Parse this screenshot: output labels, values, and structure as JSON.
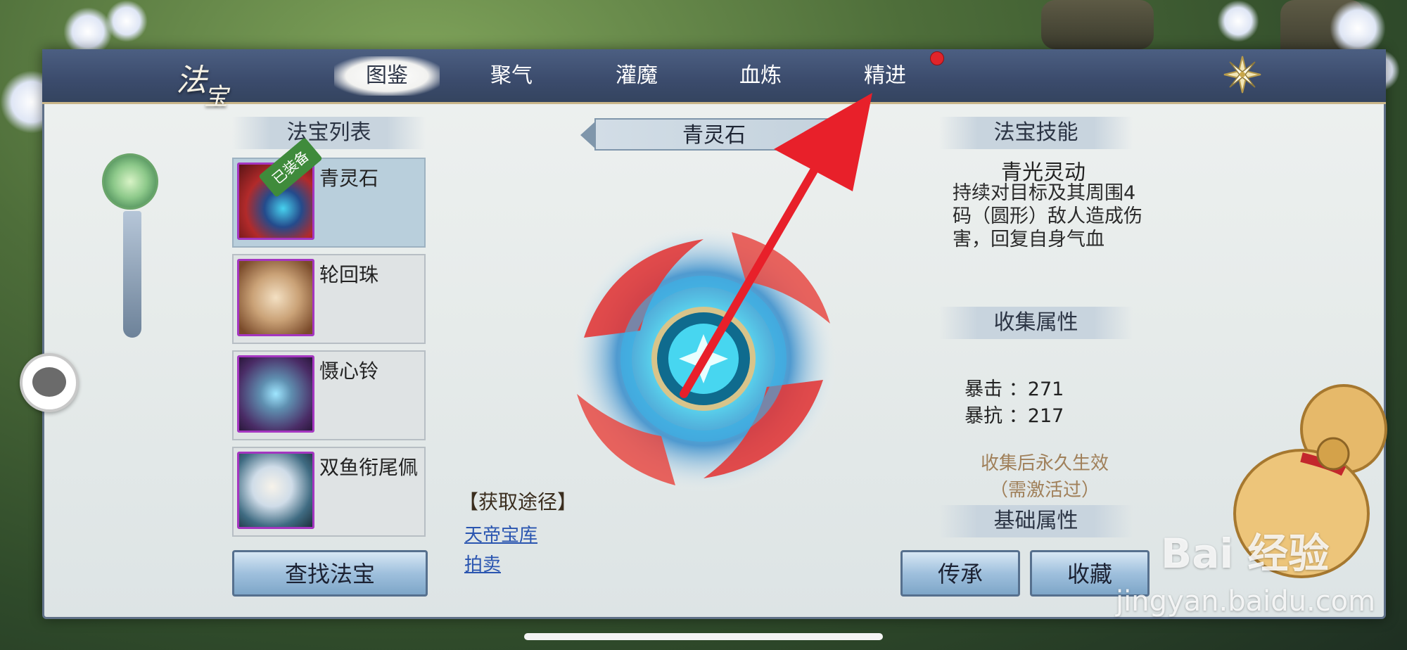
{
  "header": {
    "logo_top": "法",
    "logo_bottom": "宝",
    "tabs": [
      {
        "label": "图鉴",
        "active": true
      },
      {
        "label": "聚气",
        "active": false
      },
      {
        "label": "灌魔",
        "active": false
      },
      {
        "label": "血炼",
        "active": false
      },
      {
        "label": "精进",
        "active": false
      }
    ],
    "close_icon": "close-x-icon"
  },
  "list": {
    "title": "法宝列表",
    "items": [
      {
        "name": "青灵石",
        "equipped_tag": "已装备",
        "selected": true
      },
      {
        "name": "轮回珠",
        "selected": false
      },
      {
        "name": "慑心铃",
        "selected": false
      },
      {
        "name": "双鱼衔尾佩",
        "selected": false
      }
    ],
    "find_button": "查找法宝"
  },
  "center": {
    "title": "青灵石",
    "source_label": "【获取途径】",
    "sources": [
      "天帝宝库",
      "拍卖"
    ]
  },
  "right": {
    "skill_title": "法宝技能",
    "skill_name": "青光灵动",
    "skill_desc": "持续对目标及其周围4码（圆形）敌人造成伤害，回复自身气血",
    "collect_title": "收集属性",
    "stats": [
      {
        "label": "暴击 ：",
        "value": "271"
      },
      {
        "label": "暴抗 ：",
        "value": "217"
      }
    ],
    "note_line1": "收集后永久生效",
    "note_line2": "（需激活过）",
    "base_title": "基础属性",
    "inherit_button": "传承",
    "collect_button": "收藏"
  },
  "watermark": {
    "brand": "Bai 经验",
    "url": "jingyan.baidu.com"
  },
  "colors": {
    "arrow": "#e8202a",
    "header": "#3b4b6c",
    "accent_gold": "#c9b68a"
  }
}
